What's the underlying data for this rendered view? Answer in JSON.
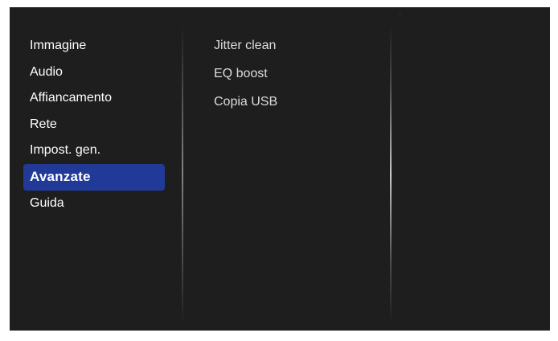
{
  "menu": {
    "items": [
      {
        "label": "Immagine"
      },
      {
        "label": "Audio"
      },
      {
        "label": "Affiancamento"
      },
      {
        "label": "Rete"
      },
      {
        "label": "Impost. gen."
      },
      {
        "label": "Avanzate",
        "selected": true
      },
      {
        "label": "Guida"
      }
    ]
  },
  "submenu": {
    "items": [
      {
        "label": "Jitter clean"
      },
      {
        "label": "EQ boost"
      },
      {
        "label": "Copia USB"
      }
    ]
  },
  "colors": {
    "background": "#1e1e1e",
    "selection": "#213a97",
    "text": "#ffffff",
    "subtext": "#dddddd"
  }
}
